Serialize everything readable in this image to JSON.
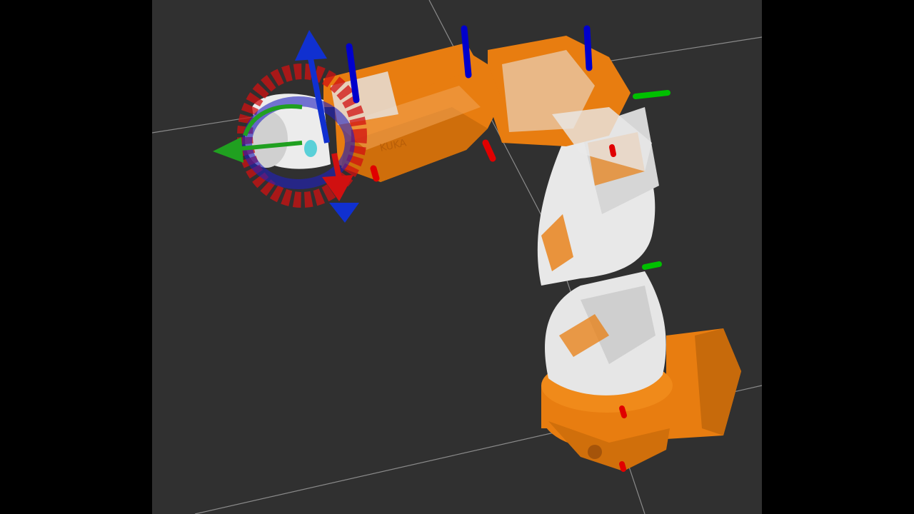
{
  "app": {
    "viewer": "3d-viewport",
    "background_color": "#303030",
    "letterbox_color": "#000000",
    "grid_color": "#a0a0a0"
  },
  "scene": {
    "robot": {
      "name": "industrial-6-axis-arm",
      "body_color": "#e87d10",
      "body_shadow_color": "#b85e08",
      "cover_color": "#e8e8e8",
      "arm_logo_text": "KUKA"
    },
    "frame_axes_colors": {
      "x": "#e00000",
      "y": "#00c000",
      "z": "#0000cc"
    },
    "interactive_marker": {
      "ring_red": "#d01010",
      "ring_blue": "#2020c0",
      "arrow_green": "#20a020",
      "arrow_blue": "#1030d0"
    }
  }
}
